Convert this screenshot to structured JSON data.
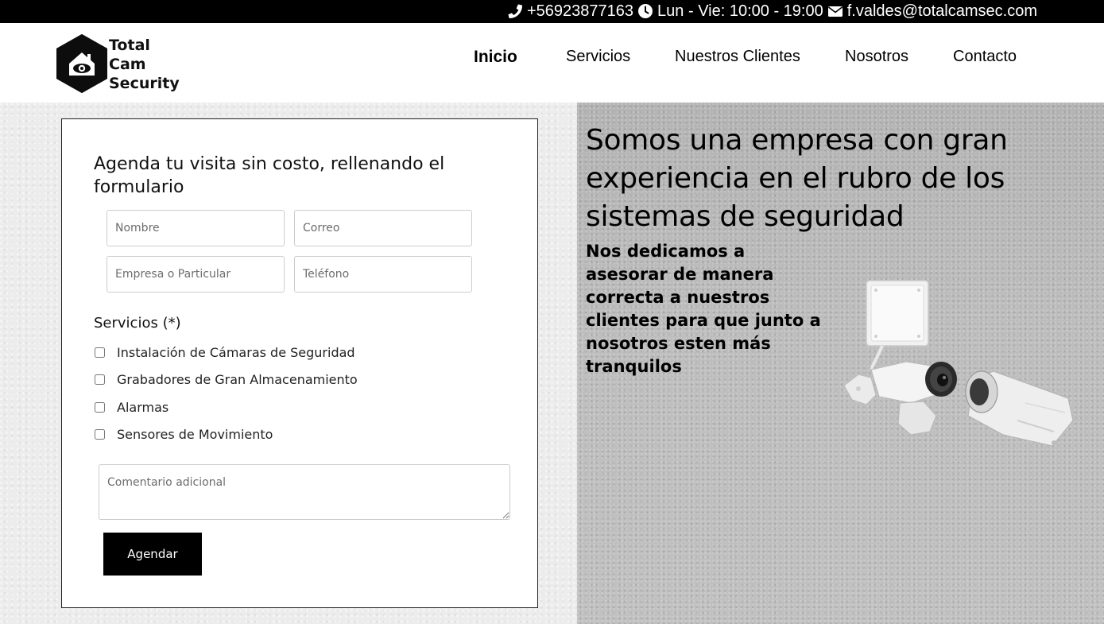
{
  "topbar": {
    "phone": "+56923877163",
    "hours": "Lun - Vie: 10:00 - 19:00",
    "email": "f.valdes@totalcamsec.com",
    "icons": [
      "phone-icon",
      "clock-icon",
      "envelope-icon"
    ]
  },
  "brand": {
    "line1": "Total",
    "line2": "Cam",
    "line3": "Security"
  },
  "nav": {
    "items": [
      {
        "label": "Inicio",
        "active": true
      },
      {
        "label": "Servicios",
        "active": false
      },
      {
        "label": "Nuestros Clientes",
        "active": false
      },
      {
        "label": "Nosotros",
        "active": false
      },
      {
        "label": "Contacto",
        "active": false
      }
    ]
  },
  "form": {
    "title": "Agenda tu visita sin costo, rellenando el formulario",
    "fields": {
      "name_placeholder": "Nombre",
      "email_placeholder": "Correo",
      "company_placeholder": "Empresa o Particular",
      "phone_placeholder": "Teléfono"
    },
    "services_label": "Servicios (*)",
    "services": [
      {
        "label": "Instalación de Cámaras de Seguridad",
        "checked": false
      },
      {
        "label": "Grabadores de Gran Almacenamiento",
        "checked": false
      },
      {
        "label": "Alarmas",
        "checked": false
      },
      {
        "label": "Sensores de Movimiento",
        "checked": false
      }
    ],
    "comment_placeholder": "Comentario adicional",
    "submit_label": "Agendar"
  },
  "hero": {
    "title": "Somos una empresa con gran experiencia en el rubro de los sistemas de seguridad",
    "subtitle": "Nos dedicamos a asesorar de manera correcta a nuestros clientes para que junto a nosotros esten más tranquilos"
  },
  "colors": {
    "topbar_bg": "#000000",
    "button_bg": "#000000",
    "text": "#111111"
  }
}
